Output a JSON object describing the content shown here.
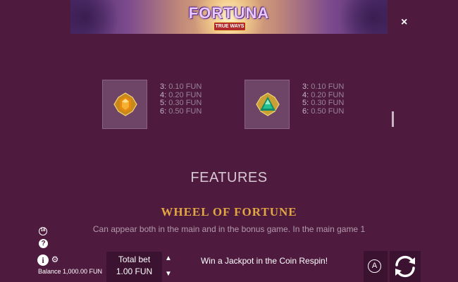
{
  "banner": {
    "logo_text": "FORTUNA",
    "ways_text": "TRUE WAYS"
  },
  "close_label": "×",
  "symbols": [
    {
      "icon": "orange-gem-icon",
      "color": "#e79a12",
      "pays": [
        {
          "n": "3:",
          "v": "0.10 FUN"
        },
        {
          "n": "4:",
          "v": "0.20 FUN"
        },
        {
          "n": "5:",
          "v": "0.30 FUN"
        },
        {
          "n": "6:",
          "v": "0.50 FUN"
        }
      ]
    },
    {
      "icon": "green-gem-icon",
      "color": "#1fae86",
      "pays": [
        {
          "n": "3:",
          "v": "0.10 FUN"
        },
        {
          "n": "4:",
          "v": "0.20 FUN"
        },
        {
          "n": "5:",
          "v": "0.30 FUN"
        },
        {
          "n": "6:",
          "v": "0.50 FUN"
        }
      ]
    }
  ],
  "features_heading": "FEATURES",
  "wheel": {
    "title": "WHEEL OF FORTUNE",
    "description": "Can appear both in the main and in the bonus game. In the main game 1"
  },
  "footer": {
    "age_badge": "18",
    "help_icon": "?",
    "info_icon": "i",
    "settings_icon": "⚙",
    "balance": "Balance 1,000.00 FUN",
    "total_bet_label": "Total bet",
    "total_bet_value": "1.00 FUN",
    "message": "Win a Jackpot in the Coin Respin!",
    "auto_label": "A"
  },
  "colors": {
    "background": "#4e1b3f",
    "accent_gold": "#e2a642",
    "panel": "#3b1230"
  }
}
